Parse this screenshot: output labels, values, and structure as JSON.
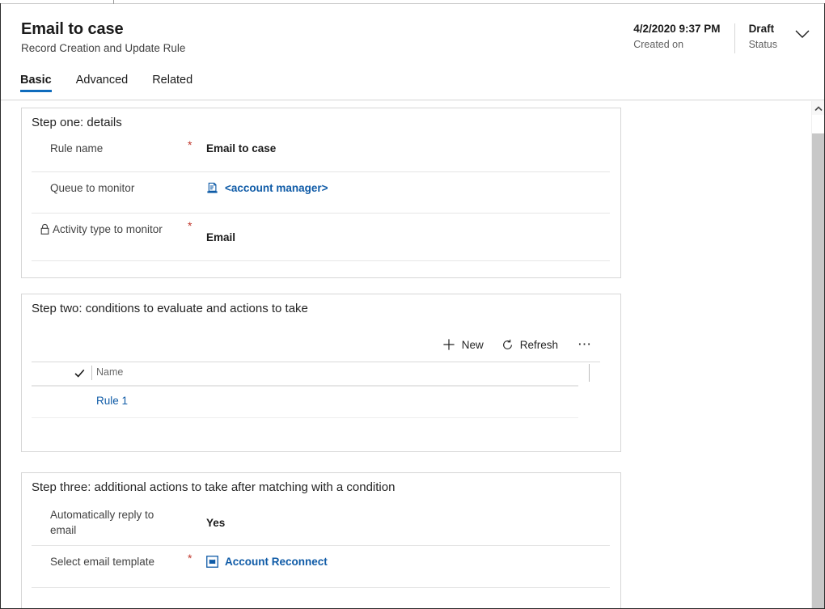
{
  "header": {
    "title": "Email to case",
    "subtitle": "Record Creation and Update Rule",
    "tabs": [
      {
        "label": "Basic",
        "active": true
      },
      {
        "label": "Advanced",
        "active": false
      },
      {
        "label": "Related",
        "active": false
      }
    ],
    "created_on": {
      "value": "4/2/2020 9:37 PM",
      "label": "Created on"
    },
    "status": {
      "value": "Draft",
      "label": "Status"
    },
    "expand_icon": "chevron-down-icon"
  },
  "accent_color": "#0f6cbd",
  "link_color": "#0f5ba7",
  "required_color": "#c0372c",
  "step_one": {
    "title": "Step one: details",
    "fields": [
      {
        "label": "Rule name",
        "required": "*",
        "value": "Email to case",
        "icon": null,
        "locked": false,
        "link": false
      },
      {
        "label": "Queue to monitor",
        "required": "",
        "value": "<account manager>",
        "icon": "queue-icon",
        "locked": false,
        "link": true
      },
      {
        "label": "Activity type to monitor",
        "required": "*",
        "value": "Email",
        "icon": null,
        "locked": true,
        "lock_icon": "lock-icon",
        "link": false
      }
    ]
  },
  "step_two": {
    "title": "Step two: conditions to evaluate and actions to take",
    "toolbar": [
      {
        "label": "New",
        "icon": "plus-icon"
      },
      {
        "label": "Refresh",
        "icon": "refresh-icon"
      },
      {
        "label": "⋯",
        "icon": "more-icon"
      }
    ],
    "grid": {
      "select_all_icon": "checkmark-icon",
      "columns": [
        "Name"
      ],
      "rows": [
        {
          "name": "Rule 1"
        }
      ]
    }
  },
  "step_three": {
    "title": "Step three: additional actions to take after matching with a condition",
    "fields": [
      {
        "label": "Automatically reply to email",
        "required": "",
        "value": "Yes",
        "icon": null,
        "link": false
      },
      {
        "label": "Select email template",
        "required": "*",
        "value": "Account Reconnect",
        "icon": "email-template-icon",
        "link": true
      }
    ]
  },
  "scrollbar": {
    "up_arrow_icon": "chevron-up-icon"
  }
}
